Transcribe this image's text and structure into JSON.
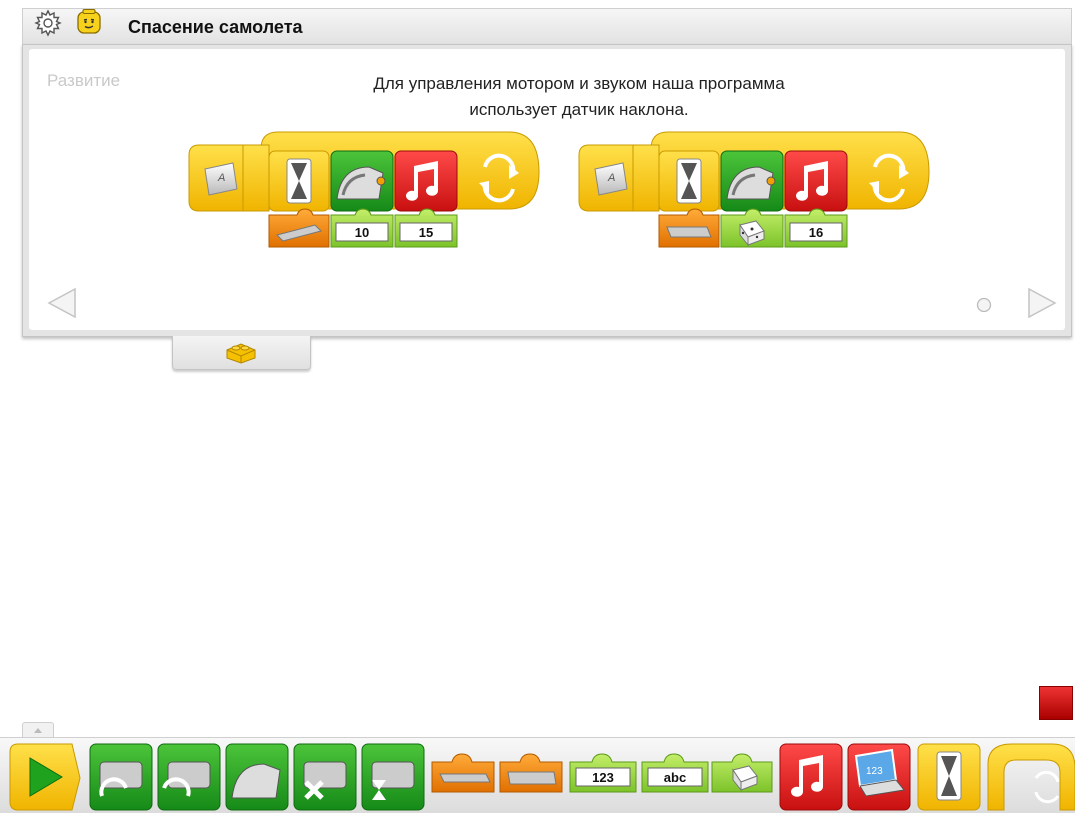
{
  "header": {
    "title": "Спасение самолета",
    "icons": [
      "gear-icon",
      "minifigure-face-icon"
    ]
  },
  "activity": {
    "phase_label": "Развитие",
    "description_line1": "Для управления мотором и звуком наша программа",
    "description_line2": "использует датчик наклона.",
    "program1": {
      "start_key": "A",
      "blocks": [
        "wait-block",
        "motor-power-block",
        "sound-block",
        "repeat-block"
      ],
      "inputs": [
        "tilt-sensor",
        "10",
        "15"
      ]
    },
    "program2": {
      "start_key": "A",
      "blocks": [
        "wait-block",
        "motor-power-block",
        "sound-block",
        "repeat-block"
      ],
      "inputs": [
        "tilt-sensor",
        "random",
        "16"
      ]
    }
  },
  "palette": {
    "number_label": "123",
    "text_label": "abc",
    "blocks": [
      "start-block",
      "motor-this-way",
      "motor-that-way",
      "motor-power",
      "motor-off",
      "motor-on-for",
      "tilt-sensor-input",
      "distance-sensor-input",
      "number-input",
      "text-input",
      "random-input",
      "sound-block",
      "display-block",
      "wait-block",
      "repeat-block"
    ]
  },
  "colors": {
    "yellow": "#f5c518",
    "green": "#27a826",
    "red": "#e02525",
    "orange": "#f08a18",
    "light_green": "#9fd848"
  }
}
